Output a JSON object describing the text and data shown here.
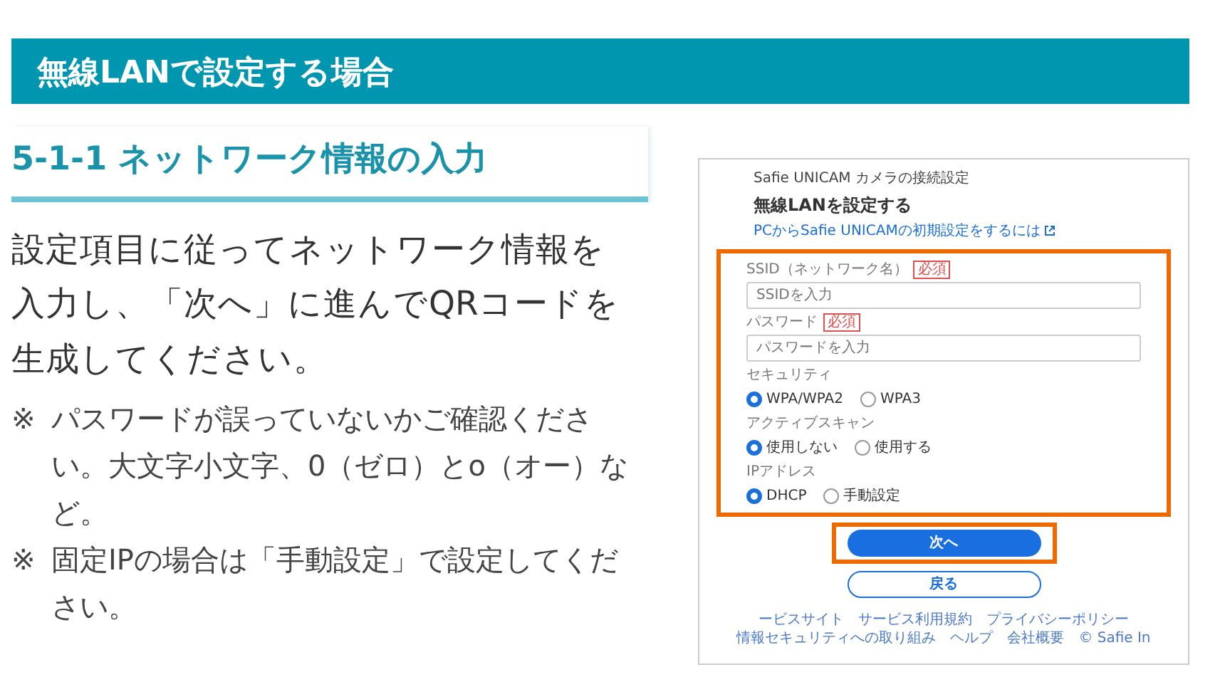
{
  "banner": {
    "title": "無線LANで設定する場合"
  },
  "section": {
    "heading": "5-1-1 ネットワーク情報の入力"
  },
  "instructions": "設定項目に従ってネットワーク情報を入力し、「次へ」に進んでQRコードを生成してください。",
  "notes": [
    {
      "mark": "※",
      "text": "パスワードが誤っていないかご確認ください。大文字小文字、0（ゼロ）とo（オー）など。"
    },
    {
      "mark": "※",
      "text": "固定IPの場合は「手動設定」で設定してください。"
    }
  ],
  "screenshot": {
    "app_name": "Safie UNICAM カメラの接続設定",
    "title": "無線LANを設定する",
    "help_link": "PCからSafie UNICAMの初期設定をするには",
    "form_highlighted": true,
    "fields": [
      {
        "label": "SSID（ネットワーク名）",
        "required_badge": "必須",
        "placeholder": "SSIDを入力"
      },
      {
        "label": "パスワード",
        "required_badge": "必須",
        "placeholder": "パスワードを入力"
      }
    ],
    "radio_groups": [
      {
        "label": "セキュリティ",
        "options": [
          {
            "label": "WPA/WPA2",
            "selected": true
          },
          {
            "label": "WPA3",
            "selected": false
          }
        ]
      },
      {
        "label": "アクティブスキャン",
        "options": [
          {
            "label": "使用しない",
            "selected": true
          },
          {
            "label": "使用する",
            "selected": false
          }
        ]
      },
      {
        "label": "IPアドレス",
        "options": [
          {
            "label": "DHCP",
            "selected": true
          },
          {
            "label": "手動設定",
            "selected": false
          }
        ]
      }
    ],
    "buttons": [
      {
        "label": "次へ",
        "kind": "primary",
        "highlighted": true
      },
      {
        "label": "戻る",
        "kind": "outline",
        "highlighted": false
      }
    ],
    "footer_links": [
      "ービスサイト",
      "サービス利用規約",
      "プライバシーポリシー",
      "情報セキュリティへの取り組み",
      "ヘルプ",
      "会社概要",
      "© Safie In"
    ]
  }
}
